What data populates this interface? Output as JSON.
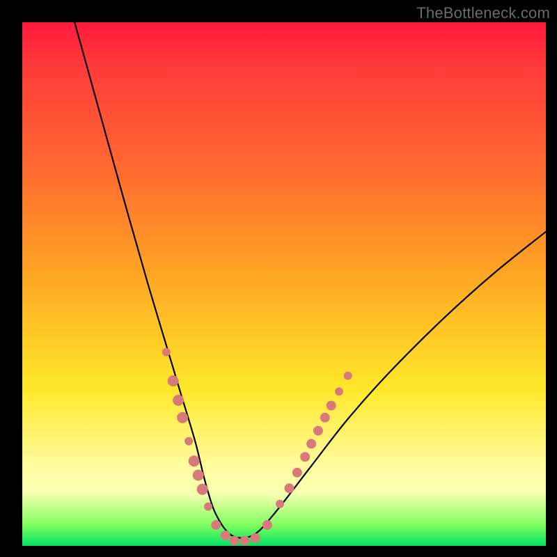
{
  "watermark": "TheBottleneck.com",
  "chart_data": {
    "type": "line",
    "title": "",
    "xlabel": "",
    "ylabel": "",
    "xlim": [
      0,
      1
    ],
    "ylim": [
      0,
      1
    ],
    "series": [
      {
        "name": "curve",
        "x": [
          0.1,
          0.15,
          0.2,
          0.24,
          0.27,
          0.3,
          0.33,
          0.35,
          0.37,
          0.4,
          0.44,
          0.48,
          0.55,
          0.62,
          0.7,
          0.8,
          0.9,
          1.0
        ],
        "y": [
          1.0,
          0.82,
          0.64,
          0.5,
          0.4,
          0.3,
          0.2,
          0.12,
          0.06,
          0.02,
          0.02,
          0.06,
          0.15,
          0.24,
          0.33,
          0.43,
          0.52,
          0.6
        ]
      }
    ],
    "markers": [
      {
        "name": "dots",
        "color": "#d97a7a",
        "points": [
          {
            "x": 0.275,
            "y": 0.37,
            "r": 6
          },
          {
            "x": 0.288,
            "y": 0.315,
            "r": 8
          },
          {
            "x": 0.298,
            "y": 0.278,
            "r": 8
          },
          {
            "x": 0.306,
            "y": 0.245,
            "r": 8
          },
          {
            "x": 0.318,
            "y": 0.2,
            "r": 6
          },
          {
            "x": 0.328,
            "y": 0.162,
            "r": 8
          },
          {
            "x": 0.336,
            "y": 0.135,
            "r": 8
          },
          {
            "x": 0.344,
            "y": 0.108,
            "r": 8
          },
          {
            "x": 0.355,
            "y": 0.075,
            "r": 6
          },
          {
            "x": 0.37,
            "y": 0.04,
            "r": 7
          },
          {
            "x": 0.388,
            "y": 0.02,
            "r": 7
          },
          {
            "x": 0.405,
            "y": 0.01,
            "r": 7
          },
          {
            "x": 0.425,
            "y": 0.01,
            "r": 7
          },
          {
            "x": 0.445,
            "y": 0.015,
            "r": 7
          },
          {
            "x": 0.468,
            "y": 0.04,
            "r": 7
          },
          {
            "x": 0.492,
            "y": 0.08,
            "r": 6
          },
          {
            "x": 0.51,
            "y": 0.11,
            "r": 7
          },
          {
            "x": 0.525,
            "y": 0.14,
            "r": 7
          },
          {
            "x": 0.54,
            "y": 0.17,
            "r": 7
          },
          {
            "x": 0.552,
            "y": 0.195,
            "r": 7
          },
          {
            "x": 0.565,
            "y": 0.22,
            "r": 7
          },
          {
            "x": 0.578,
            "y": 0.245,
            "r": 7
          },
          {
            "x": 0.59,
            "y": 0.268,
            "r": 7
          },
          {
            "x": 0.605,
            "y": 0.295,
            "r": 6
          },
          {
            "x": 0.622,
            "y": 0.325,
            "r": 6
          }
        ]
      }
    ]
  }
}
